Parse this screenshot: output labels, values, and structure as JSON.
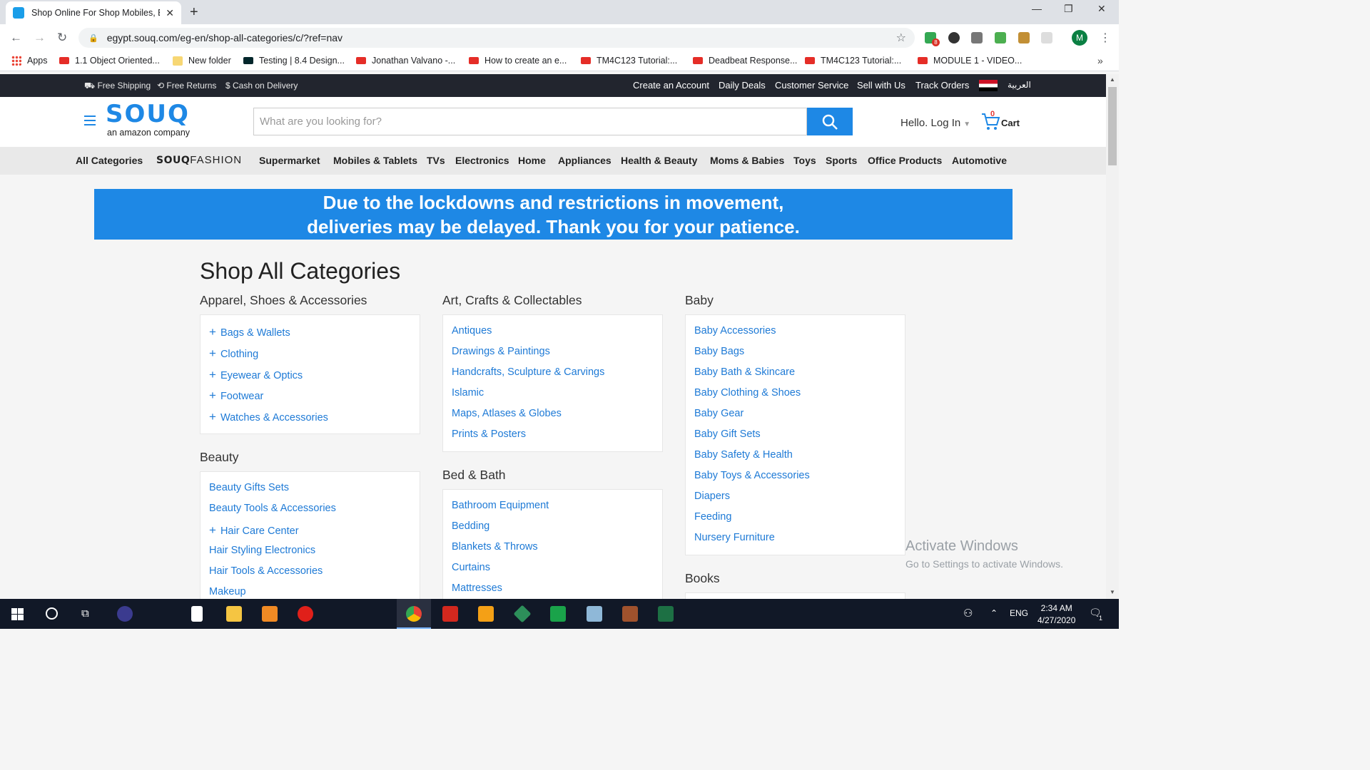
{
  "browser": {
    "tab_title": "Shop Online For Shop Mobiles, E",
    "url": "egypt.souq.com/eg-en/shop-all-categories/c/?ref=nav",
    "bookmarks": [
      "Apps",
      "1.1 Object Oriented...",
      "New folder",
      "Testing | 8.4 Design...",
      "Jonathan Valvano -...",
      "How to create an e...",
      "TM4C123 Tutorial:...",
      "Deadbeat Response...",
      "TM4C123 Tutorial:...",
      "MODULE 1 - VIDEO..."
    ],
    "avatar_letter": "M",
    "extension_badge": "8"
  },
  "topstrip": {
    "free_shipping": "Free Shipping",
    "free_returns": "Free Returns",
    "cash_on_delivery": "Cash on Delivery",
    "links": [
      "Create an Account",
      "Daily Deals",
      "Customer Service",
      "Sell with Us",
      "Track Orders"
    ],
    "language": "العربية"
  },
  "header": {
    "logo": "SOUQ",
    "logo_sub": "an amazon company",
    "search_placeholder": "What are you looking for?",
    "login": "Hello. Log In",
    "cart_label": "Cart",
    "cart_count": "0"
  },
  "catnav": {
    "all": "All Categories",
    "fashion_souq": "SOUQ",
    "fashion_word": "FASHION",
    "items": [
      "Supermarket",
      "Mobiles & Tablets",
      "TVs",
      "Electronics",
      "Home",
      "Appliances",
      "Health & Beauty",
      "Moms & Babies",
      "Toys",
      "Sports",
      "Office Products",
      "Automotive"
    ]
  },
  "banner": {
    "line1": "Due to the lockdowns and restrictions in movement,",
    "line2": "deliveries may be delayed. Thank you for your patience."
  },
  "page_title": "Shop All Categories",
  "columns": {
    "apparel": {
      "title": "Apparel, Shoes & Accessories",
      "items": [
        "Bags & Wallets",
        "Clothing",
        "Eyewear & Optics",
        "Footwear",
        "Watches & Accessories"
      ]
    },
    "beauty": {
      "title": "Beauty",
      "items": [
        "Beauty Gifts Sets",
        "Beauty Tools & Accessories",
        "Hair Care Center",
        "Hair Styling Electronics",
        "Hair Tools & Accessories",
        "Makeup"
      ]
    },
    "art": {
      "title": "Art, Crafts & Collectables",
      "items": [
        "Antiques",
        "Drawings & Paintings",
        "Handcrafts, Sculpture & Carvings",
        "Islamic",
        "Maps, Atlases & Globes",
        "Prints & Posters"
      ]
    },
    "bed": {
      "title": "Bed & Bath",
      "items": [
        "Bathroom Equipment",
        "Bedding",
        "Blankets & Throws",
        "Curtains",
        "Mattresses"
      ]
    },
    "baby": {
      "title": "Baby",
      "items": [
        "Baby Accessories",
        "Baby Bags",
        "Baby Bath & Skincare",
        "Baby Clothing & Shoes",
        "Baby Gear",
        "Baby Gift Sets",
        "Baby Safety & Health",
        "Baby Toys & Accessories",
        "Diapers",
        "Feeding",
        "Nursery Furniture"
      ]
    },
    "books": {
      "title": "Books"
    }
  },
  "watermark": {
    "line1": "Activate Windows",
    "line2": "Go to Settings to activate Windows."
  },
  "taskbar": {
    "lang": "ENG",
    "time": "2:34 AM",
    "date": "4/27/2020",
    "notif_count": "1"
  }
}
